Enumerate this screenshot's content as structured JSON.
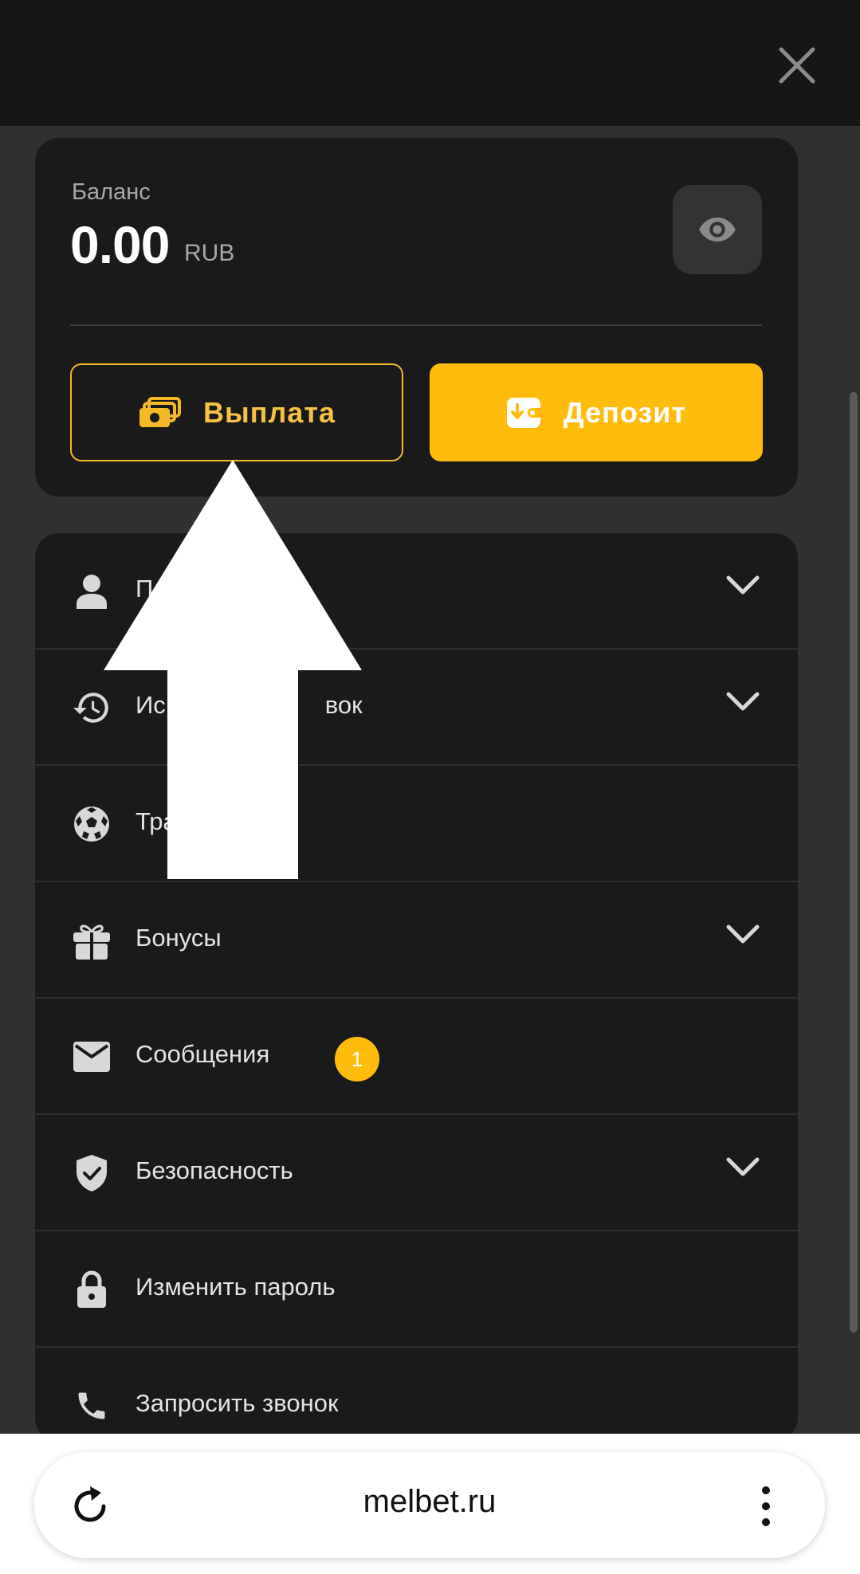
{
  "balance": {
    "label": "Баланс",
    "amount": "0.00",
    "currency": "RUB"
  },
  "actions": {
    "withdraw_label": "Выплата",
    "deposit_label": "Депозит"
  },
  "menu": {
    "items": [
      {
        "label": "П",
        "icon": "person-icon",
        "has_chevron": true
      },
      {
        "label": "Ис",
        "label_tail": "вок",
        "icon": "history-icon",
        "has_chevron": true
      },
      {
        "label": "Тра",
        "icon": "soccer-ball-icon",
        "has_chevron": false
      },
      {
        "label": "Бонусы",
        "icon": "gift-icon",
        "has_chevron": true
      },
      {
        "label": "Сообщения",
        "icon": "mail-icon",
        "has_chevron": false,
        "badge": "1"
      },
      {
        "label": "Безопасность",
        "icon": "shield-check-icon",
        "has_chevron": true
      },
      {
        "label": "Изменить пароль",
        "icon": "lock-icon",
        "has_chevron": false
      },
      {
        "label": "Запросить звонок",
        "icon": "phone-icon",
        "has_chevron": false
      }
    ]
  },
  "browser": {
    "url": "melbet.ru"
  },
  "colors": {
    "accent": "#ffbc0d",
    "background": "#303030",
    "card": "#1a1a1a",
    "topbar": "#161616"
  }
}
